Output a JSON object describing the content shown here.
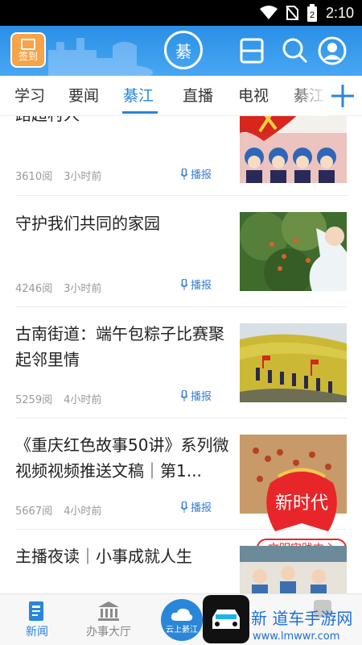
{
  "status_bar": {
    "time": "2:10",
    "battery_level": "2"
  },
  "header": {
    "signin_label": "签到",
    "logo_char": "綦",
    "colors": {
      "bg": "#2a8fe6",
      "accent": "#2a86d8"
    }
  },
  "tabs": [
    {
      "label": "学习"
    },
    {
      "label": "要闻"
    },
    {
      "label": "綦江",
      "active": true
    },
    {
      "label": "直播"
    },
    {
      "label": "电视"
    },
    {
      "label": "綦江"
    }
  ],
  "feed": [
    {
      "title": "路超村人",
      "views": "3610阅",
      "time": "3小时前",
      "broadcast": "播报"
    },
    {
      "title": "守护我们共同的家园",
      "views": "4246阅",
      "time": "3小时前",
      "broadcast": "播报"
    },
    {
      "title": "古南街道：端午包粽子比赛聚起邻里情",
      "views": "5259阅",
      "time": "4小时前",
      "broadcast": "播报"
    },
    {
      "title": "《重庆红色故事50讲》系列微视频视频推送文稿｜第1...",
      "views": "5667阅",
      "time": "4小时前",
      "broadcast": "播报"
    },
    {
      "title": "主播夜读｜小事成就人生",
      "views": "",
      "time": "",
      "broadcast": ""
    }
  ],
  "thumb_texts": {
    "banner_1": "新时代",
    "banner_2": "文明实践中心"
  },
  "bottom_nav": [
    {
      "label": "新闻",
      "active": true
    },
    {
      "label": "办事大厅"
    },
    {
      "label": "云上綦江"
    }
  ],
  "watermark": {
    "line1": "新 道车手游网",
    "line2": "www.lmwwr.com"
  }
}
